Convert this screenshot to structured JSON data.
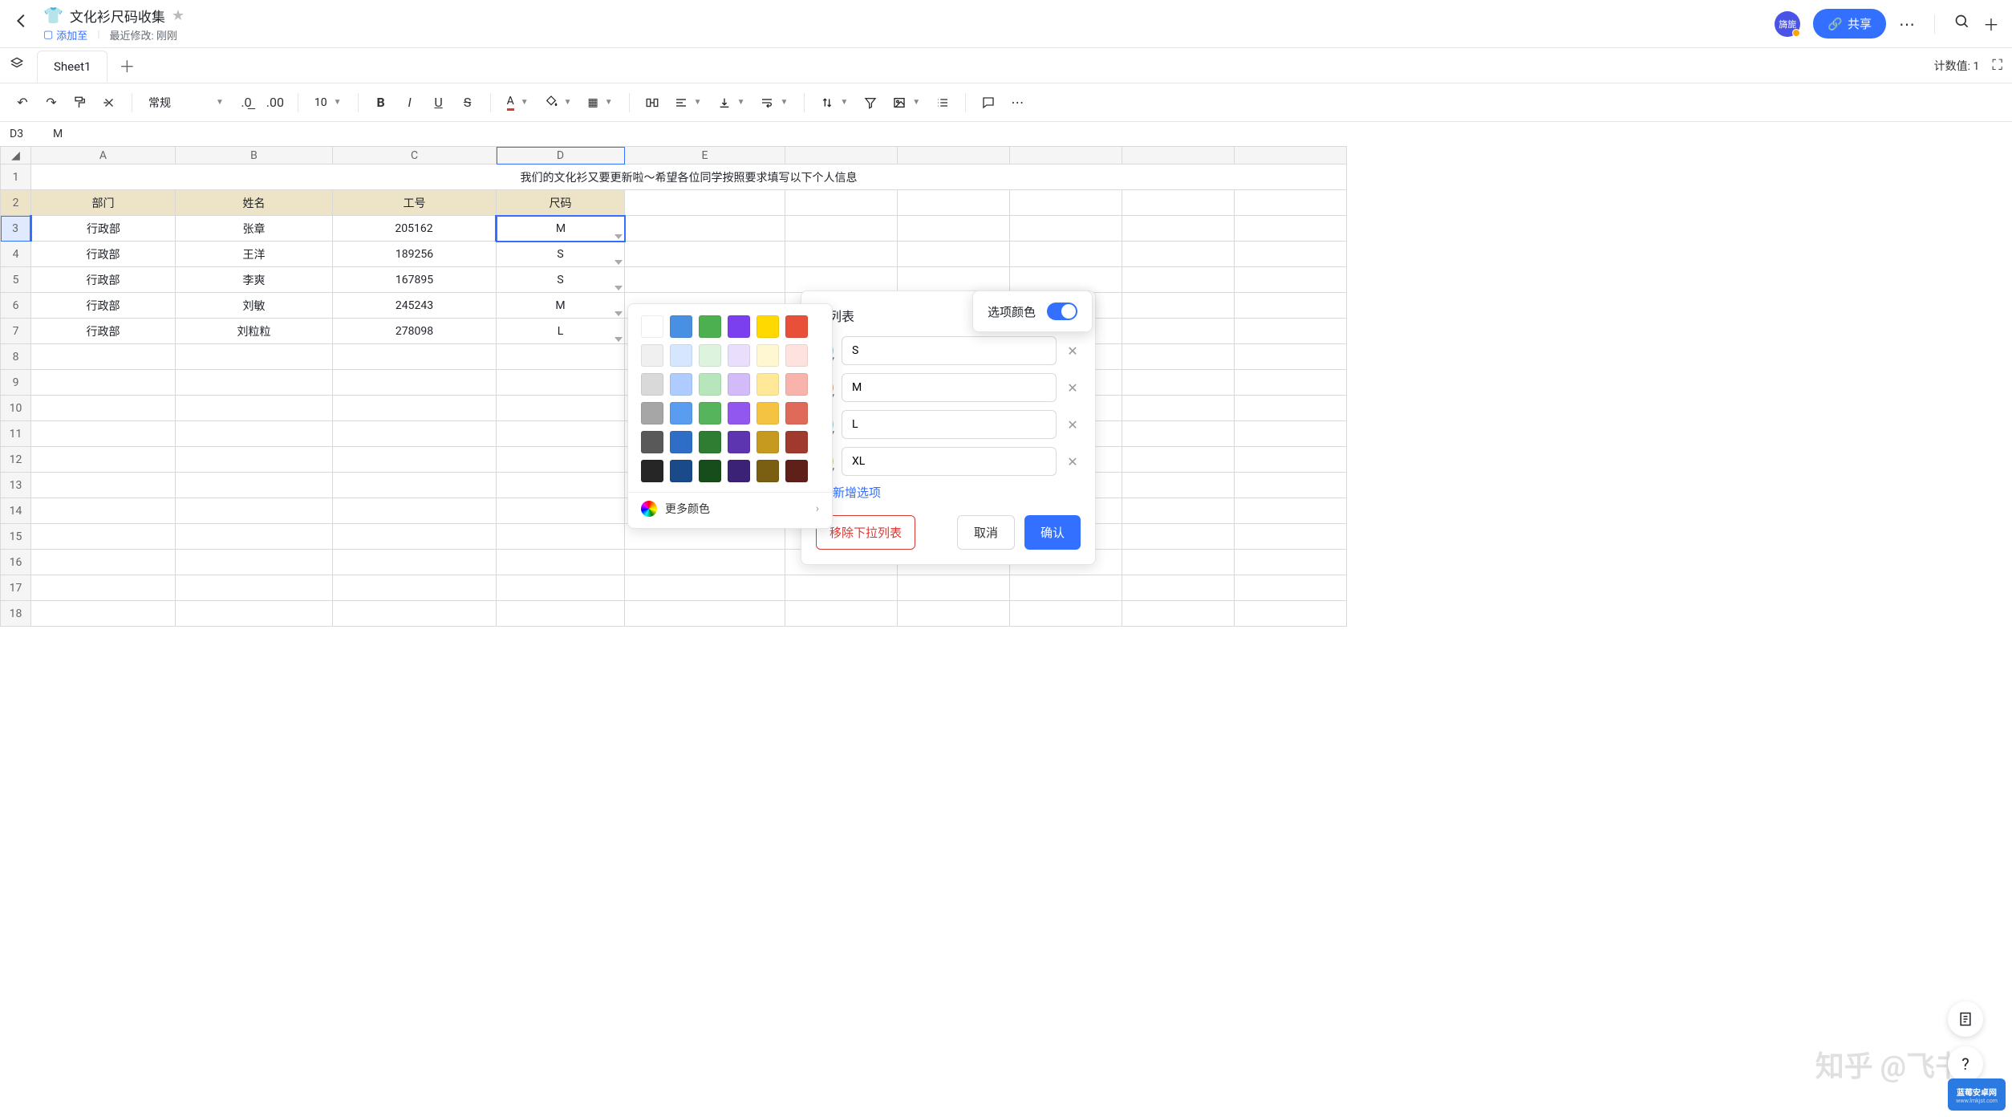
{
  "header": {
    "icon": "👕",
    "title": "文化衫尺码收集",
    "add_to": "添加至",
    "last_modified": "最近修改: 刚刚",
    "avatar_text": "旖旎",
    "share_label": "共享"
  },
  "tabs": {
    "sheet1": "Sheet1",
    "stats": "计数值: 1"
  },
  "toolbar": {
    "format_label": "常规",
    "font_size": "10"
  },
  "cellref": {
    "name": "D3",
    "value": "M"
  },
  "columns": [
    "A",
    "B",
    "C",
    "D",
    "E"
  ],
  "table": {
    "banner": "我们的文化衫又要更新啦～希望各位同学按照要求填写以下个人信息",
    "headers": {
      "dept": "部门",
      "name": "姓名",
      "empid": "工号",
      "size": "尺码"
    },
    "rows": [
      {
        "dept": "行政部",
        "name": "张章",
        "empid": "205162",
        "size": "M"
      },
      {
        "dept": "行政部",
        "name": "王洋",
        "empid": "189256",
        "size": "S"
      },
      {
        "dept": "行政部",
        "name": "李爽",
        "empid": "167895",
        "size": "S"
      },
      {
        "dept": "行政部",
        "name": "刘敏",
        "empid": "245243",
        "size": "M"
      },
      {
        "dept": "行政部",
        "name": "刘粒粒",
        "empid": "278098",
        "size": "L"
      }
    ]
  },
  "color_popover": {
    "colors": [
      "#ffffff",
      "#4a90e2",
      "#4caf50",
      "#7b3ff0",
      "#ffd900",
      "#e8503a",
      "#f0f0f0",
      "#d6e6ff",
      "#ddf3de",
      "#e9defc",
      "#fff7d1",
      "#fde2df",
      "#d9d9d9",
      "#aeccff",
      "#b7e6bc",
      "#d3bbfa",
      "#ffe999",
      "#f8b3ac",
      "#a6a6a6",
      "#5a9cf0",
      "#56b55c",
      "#9157ee",
      "#f5c342",
      "#e06a5a",
      "#595959",
      "#2f6ec7",
      "#2e7d32",
      "#5e35b1",
      "#c59a1f",
      "#a03a2e",
      "#262626",
      "#1a4a8a",
      "#174d1b",
      "#3b2277",
      "#7a5e12",
      "#5f2019"
    ],
    "more_colors": "更多颜色"
  },
  "dropdown_panel": {
    "title": "拉列表",
    "options": [
      {
        "color": "#a7c9d6",
        "value": "S"
      },
      {
        "color": "#c9b195",
        "value": "M"
      },
      {
        "color": "#a7c9d6",
        "value": "L"
      },
      {
        "color": "#d6cfa1",
        "value": "XL"
      }
    ],
    "add_label": "新增选项",
    "remove_label": "移除下拉列表",
    "cancel_label": "取消",
    "confirm_label": "确认"
  },
  "tooltip": {
    "label": "选项颜色"
  },
  "watermark": "知乎 @飞书",
  "logo": {
    "top": "蓝莓安卓网",
    "bot": "www.lmkjst.com"
  }
}
